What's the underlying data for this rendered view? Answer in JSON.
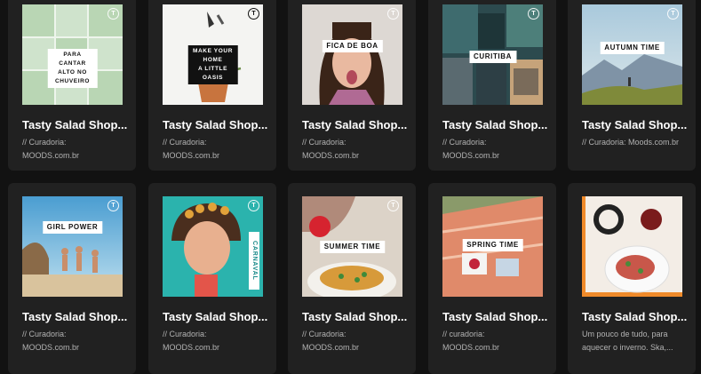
{
  "cards": [
    {
      "title": "Tasty Salad Shop...",
      "desc_line1": "// Curadoria:",
      "desc_line2": "MOODS.com.br",
      "label": "PARA CANTAR\nALTO NO CHUVEIRO",
      "badge": "T",
      "icon": "playlist-cover"
    },
    {
      "title": "Tasty Salad Shop...",
      "desc_line1": "// Curadoria:",
      "desc_line2": "MOODS.com.br",
      "label": "MAKE YOUR HOME\nA LITTLE OASIS",
      "badge": "T",
      "icon": "playlist-cover"
    },
    {
      "title": "Tasty Salad Shop...",
      "desc_line1": "// Curadoria:",
      "desc_line2": "MOODS.com.br",
      "label": "FICA DE BOA",
      "badge": "T",
      "icon": "playlist-cover"
    },
    {
      "title": "Tasty Salad Shop...",
      "desc_line1": "// Curadoria:",
      "desc_line2": "MOODS.com.br",
      "label": "CURITIBA",
      "badge": "T",
      "icon": "playlist-cover"
    },
    {
      "title": "Tasty Salad Shop...",
      "desc_line1": "// Curadoria: Moods.com.br",
      "desc_line2": "",
      "label": "AUTUMN TIME",
      "badge": "T",
      "icon": "playlist-cover"
    },
    {
      "title": "Tasty Salad Shop...",
      "desc_line1": "// Curadoria:",
      "desc_line2": "MOODS.com.br",
      "label": "GIRL POWER",
      "badge": "T",
      "icon": "playlist-cover"
    },
    {
      "title": "Tasty Salad Shop...",
      "desc_line1": "// Curadoria:",
      "desc_line2": "MOODS.com.br",
      "label": "CARNAVAL",
      "badge": "T",
      "icon": "playlist-cover"
    },
    {
      "title": "Tasty Salad Shop...",
      "desc_line1": "// Curadoria:",
      "desc_line2": "MOODS.com.br",
      "label": "SUMMER TIME",
      "badge": "T",
      "icon": "playlist-cover"
    },
    {
      "title": "Tasty Salad Shop...",
      "desc_line1": "// curadoria:",
      "desc_line2": "MOODS.com.br",
      "label": "SPRING TIME",
      "badge": "",
      "icon": "playlist-cover"
    },
    {
      "title": "Tasty Salad Shop...",
      "desc_line1": "Um pouco de tudo, para",
      "desc_line2": "aquecer o inverno. Ska,...",
      "label": "",
      "badge": "",
      "icon": "playlist-cover"
    }
  ],
  "colors": {
    "background": "#121212",
    "card": "#212121",
    "title": "#ffffff",
    "description": "#b3b3b3"
  }
}
